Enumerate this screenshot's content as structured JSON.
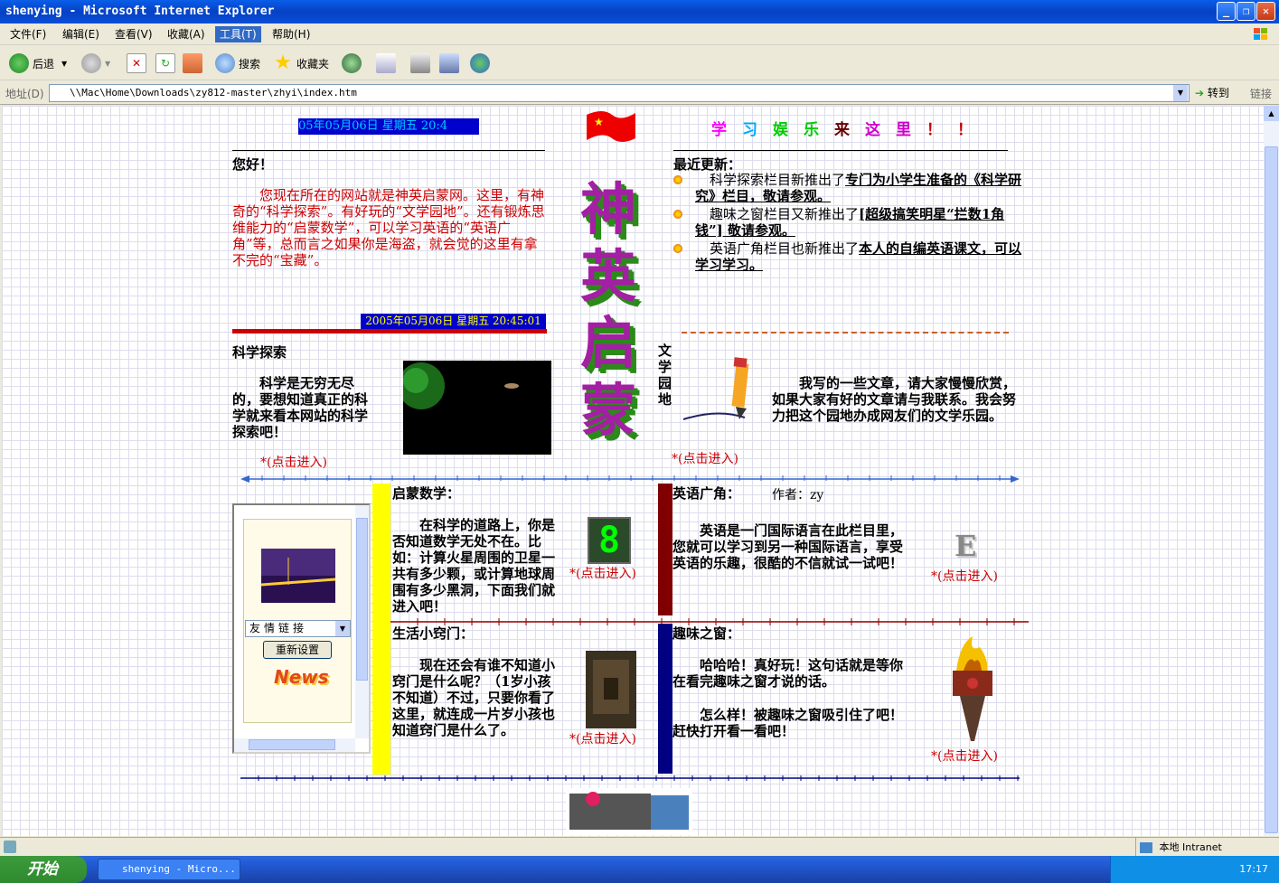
{
  "window": {
    "title": "shenying - Microsoft Internet Explorer",
    "minimize": "_",
    "restore": "❐",
    "close": "✕"
  },
  "menu": [
    "文件(F)",
    "编辑(E)",
    "查看(V)",
    "收藏(A)",
    "工具(T)",
    "帮助(H)"
  ],
  "toolbar": {
    "back": "后退",
    "search": "搜索",
    "favorites": "收藏夹"
  },
  "address": {
    "label": "地址(D)",
    "url": "\\\\Mac\\Home\\Downloads\\zy812-master\\zhyi\\index.htm",
    "go": "转到",
    "links": "链接"
  },
  "page": {
    "date_top": "05年05月06日 星期五 20:4",
    "slogan": [
      "学",
      "习",
      "娱",
      "乐",
      "来",
      "这",
      "里",
      "！",
      "！"
    ],
    "slogan_colors": [
      "#ff00ff",
      "#00aaff",
      "#00cc00",
      "#00cc00",
      "#660000",
      "#cc00cc",
      "#cc00cc",
      "#cc0000",
      "#cc0000"
    ],
    "greeting": "您好！",
    "intro": "您现在所在的网站就是神英启蒙网。这里，有神奇的“科学探索”。有好玩的“文学园地”。还有锻炼思维能力的“启蒙数学”，可以学习英语的“英语广角”等，总而言之如果你是海盗，就会觉的这里有拿不完的“宝藏”。",
    "date_mid": "2005年05月06日 星期五 20:45:01",
    "updates_title": "最近更新：",
    "updates": [
      {
        "pre": "科学探索栏目新推出了",
        "link": "专门为小学生准备的《科学研究》栏目，敬请参观。"
      },
      {
        "pre": "趣味之窗栏目又新推出了",
        "link": "[超级搞笑明星“拦数1角钱”] 敬请参观。"
      },
      {
        "pre": "英语广角栏目也新推出了",
        "link": "本人的自编英语课文，可以学习学习。"
      }
    ],
    "logo_chars": [
      "神",
      "英",
      "启",
      "蒙"
    ],
    "science_title": "科学探索",
    "science_text": "科学是无穷无尽的，要想知道真正的科学就来看本网站的科学探索吧！",
    "click_enter": "*(点击进入)",
    "literature_title": [
      "文",
      "学",
      "园",
      "地"
    ],
    "literature_text": "我写的一些文章，请大家慢慢欣赏，如果大家有好的文章请与我联系。我会努力把这个园地办成网友们的文学乐园。",
    "math_title": "启蒙数学：",
    "math_text": "在科学的道路上，你是否知道数学无处不在。比如：计算火星周围的卫星一共有多少颗，或计算地球周围有多少黑洞，下面我们就进入吧！",
    "english_title": "英语广角：",
    "english_author": "作者：zy",
    "english_text": "英语是一门国际语言在此栏目里，您就可以学习到另一种国际语言，享受英语的乐趣，很酷的不信就试一试吧！",
    "tips_title": "生活小窍门：",
    "tips_text": "现在还会有谁不知道小窍门是什么呢？（1岁小孩不知道）不过，只要你看了这里，就连成一片岁小孩也知道窍门是什么了。",
    "fun_title": "趣味之窗：",
    "fun_text1": "哈哈哈！真好玩！这句话就是等你在看完趣味之窗才说的话。",
    "fun_text2": "怎么样！被趣味之窗吸引住了吧！赶快打开看一看吧！",
    "friend_links": "友情链接",
    "reset": "重新设置",
    "news": "News",
    "digital_display": "8",
    "english_letter": "E"
  },
  "status": {
    "zone": "本地 Intranet"
  },
  "taskbar": {
    "start": "开始",
    "task": "shenying - Micro...",
    "clock": "17:17"
  }
}
